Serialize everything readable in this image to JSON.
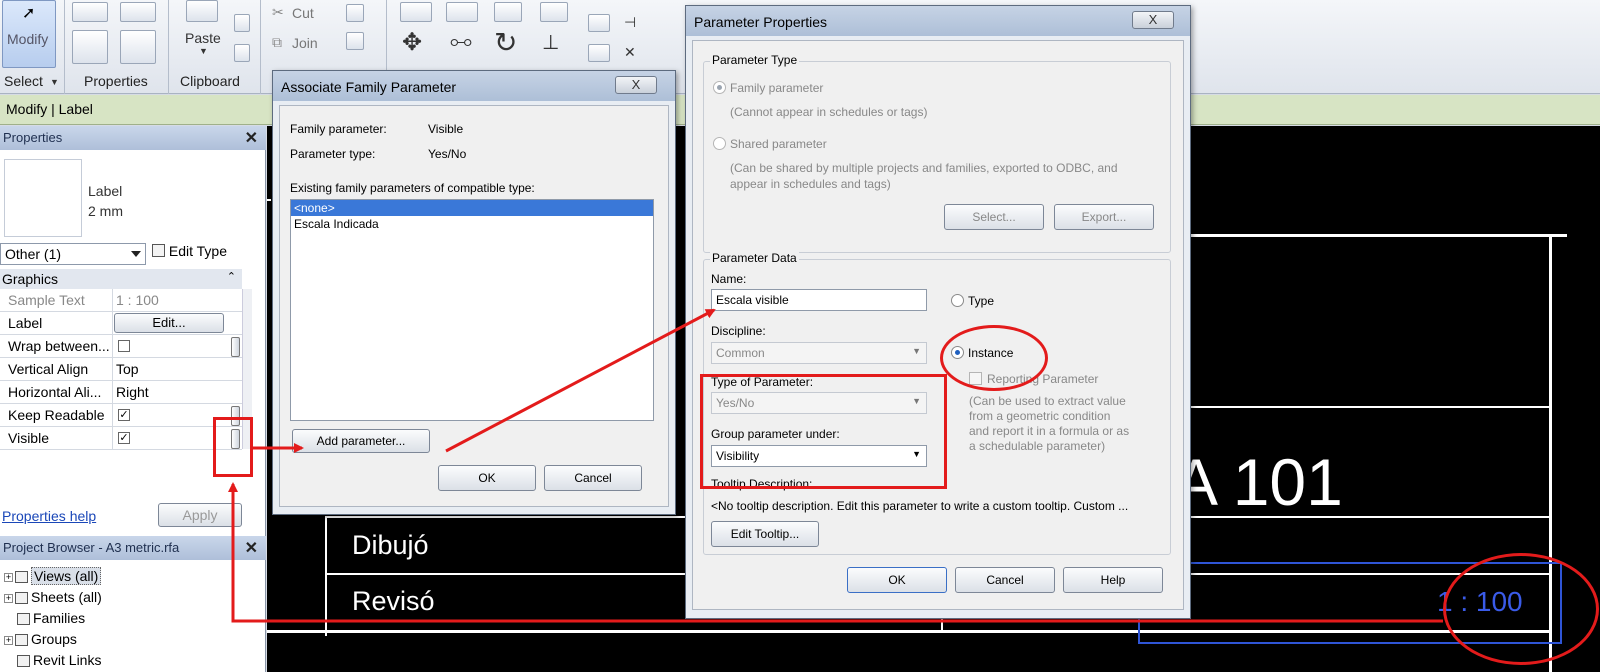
{
  "ribbon": {
    "modify_label": "Modify",
    "cut_label": "Cut",
    "join_label": "Join",
    "paste_label": "Paste",
    "panels": [
      "Select",
      "Properties",
      "Clipboard"
    ]
  },
  "context_bar": {
    "label": "Modify | Label"
  },
  "properties_palette": {
    "title": "Properties",
    "type_name_line1": "Label",
    "type_name_line2": "2 mm",
    "filter_value": "Other (1)",
    "edit_type_label": "Edit Type",
    "group": "Graphics",
    "rows": [
      {
        "key": "Sample Text",
        "value": "1 : 100"
      },
      {
        "key": "Label",
        "value": "Edit..."
      },
      {
        "key": "Wrap between...",
        "value": ""
      },
      {
        "key": "Vertical Align",
        "value": "Top"
      },
      {
        "key": "Horizontal Ali...",
        "value": "Right"
      },
      {
        "key": "Keep Readable",
        "value": "✓"
      },
      {
        "key": "Visible",
        "value": "✓"
      }
    ],
    "help_link": "Properties help",
    "apply_label": "Apply"
  },
  "project_browser": {
    "title": "Project Browser - A3 metric.rfa",
    "items": [
      "Views (all)",
      "Sheets (all)",
      "Families",
      "Groups",
      "Revit Links"
    ]
  },
  "canvas": {
    "dibujo": "Dibujó",
    "reviso": "Revisó",
    "sheet_number": "A 101",
    "scale_label": "1 : 100"
  },
  "associate_dialog": {
    "title": "Associate Family Parameter",
    "close": "X",
    "family_param_label": "Family parameter:",
    "family_param_value": "Visible",
    "param_type_label": "Parameter type:",
    "param_type_value": "Yes/No",
    "existing_label": "Existing family parameters of compatible type:",
    "list": [
      "<none>",
      "Escala Indicada"
    ],
    "add_button": "Add parameter...",
    "ok": "OK",
    "cancel": "Cancel"
  },
  "param_props_dialog": {
    "title": "Parameter Properties",
    "close": "X",
    "param_type_group": "Parameter Type",
    "family_param": "Family parameter",
    "family_note": "(Cannot appear in schedules or tags)",
    "shared_param": "Shared parameter",
    "shared_note_1": "(Can be shared by multiple projects and families, exported to ODBC, and",
    "shared_note_2": "appear in schedules and tags)",
    "select_btn": "Select...",
    "export_btn": "Export...",
    "param_data_group": "Parameter Data",
    "name_label": "Name:",
    "name_value": "Escala visible",
    "type_radio": "Type",
    "discipline_label": "Discipline:",
    "discipline_value": "Common",
    "instance_radio": "Instance",
    "type_of_param_label": "Type of Parameter:",
    "type_of_param_value": "Yes/No",
    "reporting": "Reporting Parameter",
    "reporting_note_1": "(Can be used to extract value",
    "reporting_note_2": "from a geometric condition",
    "reporting_note_3": "and report it in a formula or as",
    "reporting_note_4": "a schedulable parameter)",
    "group_under_label": "Group parameter under:",
    "group_under_value": "Visibility",
    "tooltip_label": "Tooltip Description:",
    "tooltip_value": "<No tooltip description. Edit this parameter to write a custom tooltip. Custom ...",
    "edit_tooltip": "Edit Tooltip...",
    "ok": "OK",
    "cancel": "Cancel",
    "help": "Help"
  }
}
